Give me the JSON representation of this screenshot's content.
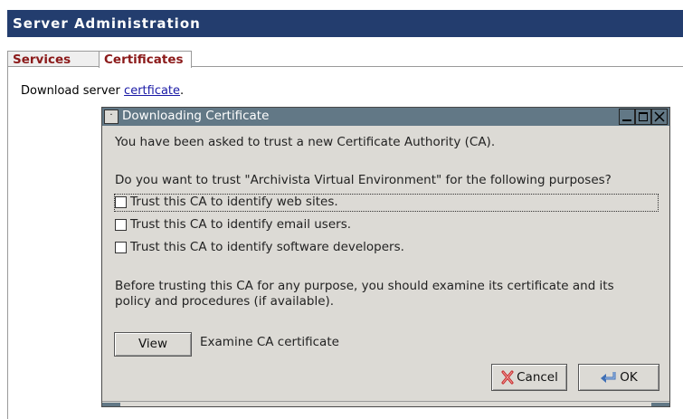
{
  "header": {
    "title": "Server Administration"
  },
  "tabs": [
    {
      "label": "Services",
      "active": false
    },
    {
      "label": "Certificates",
      "active": true
    }
  ],
  "content": {
    "download_prefix": "Download server ",
    "download_link": "certficate",
    "download_suffix": "."
  },
  "dialog": {
    "title": "Downloading Certificate",
    "menu_glyph": "·",
    "intro": "You have been asked to trust a new Certificate Authority (CA).",
    "question": "Do you want to trust \"Archivista Virtual Environment\" for the following purposes?",
    "options": [
      {
        "label": "Trust this CA to identify web sites.",
        "checked": false
      },
      {
        "label": "Trust this CA to identify email users.",
        "checked": false
      },
      {
        "label": "Trust this CA to identify software developers.",
        "checked": false
      }
    ],
    "warning_line1": "Before trusting this CA for any purpose, you should examine its certificate and its",
    "warning_line2": "policy and procedures (if available).",
    "view_button": "View",
    "examine_label": "Examine CA certificate",
    "cancel_button": "Cancel",
    "ok_button": "OK"
  },
  "colors": {
    "header_bg": "#233d6e",
    "tab_text": "#8b1a1a",
    "titlebar_bg": "#627886",
    "dialog_bg": "#dcdad5",
    "link": "#1a1aa6"
  }
}
